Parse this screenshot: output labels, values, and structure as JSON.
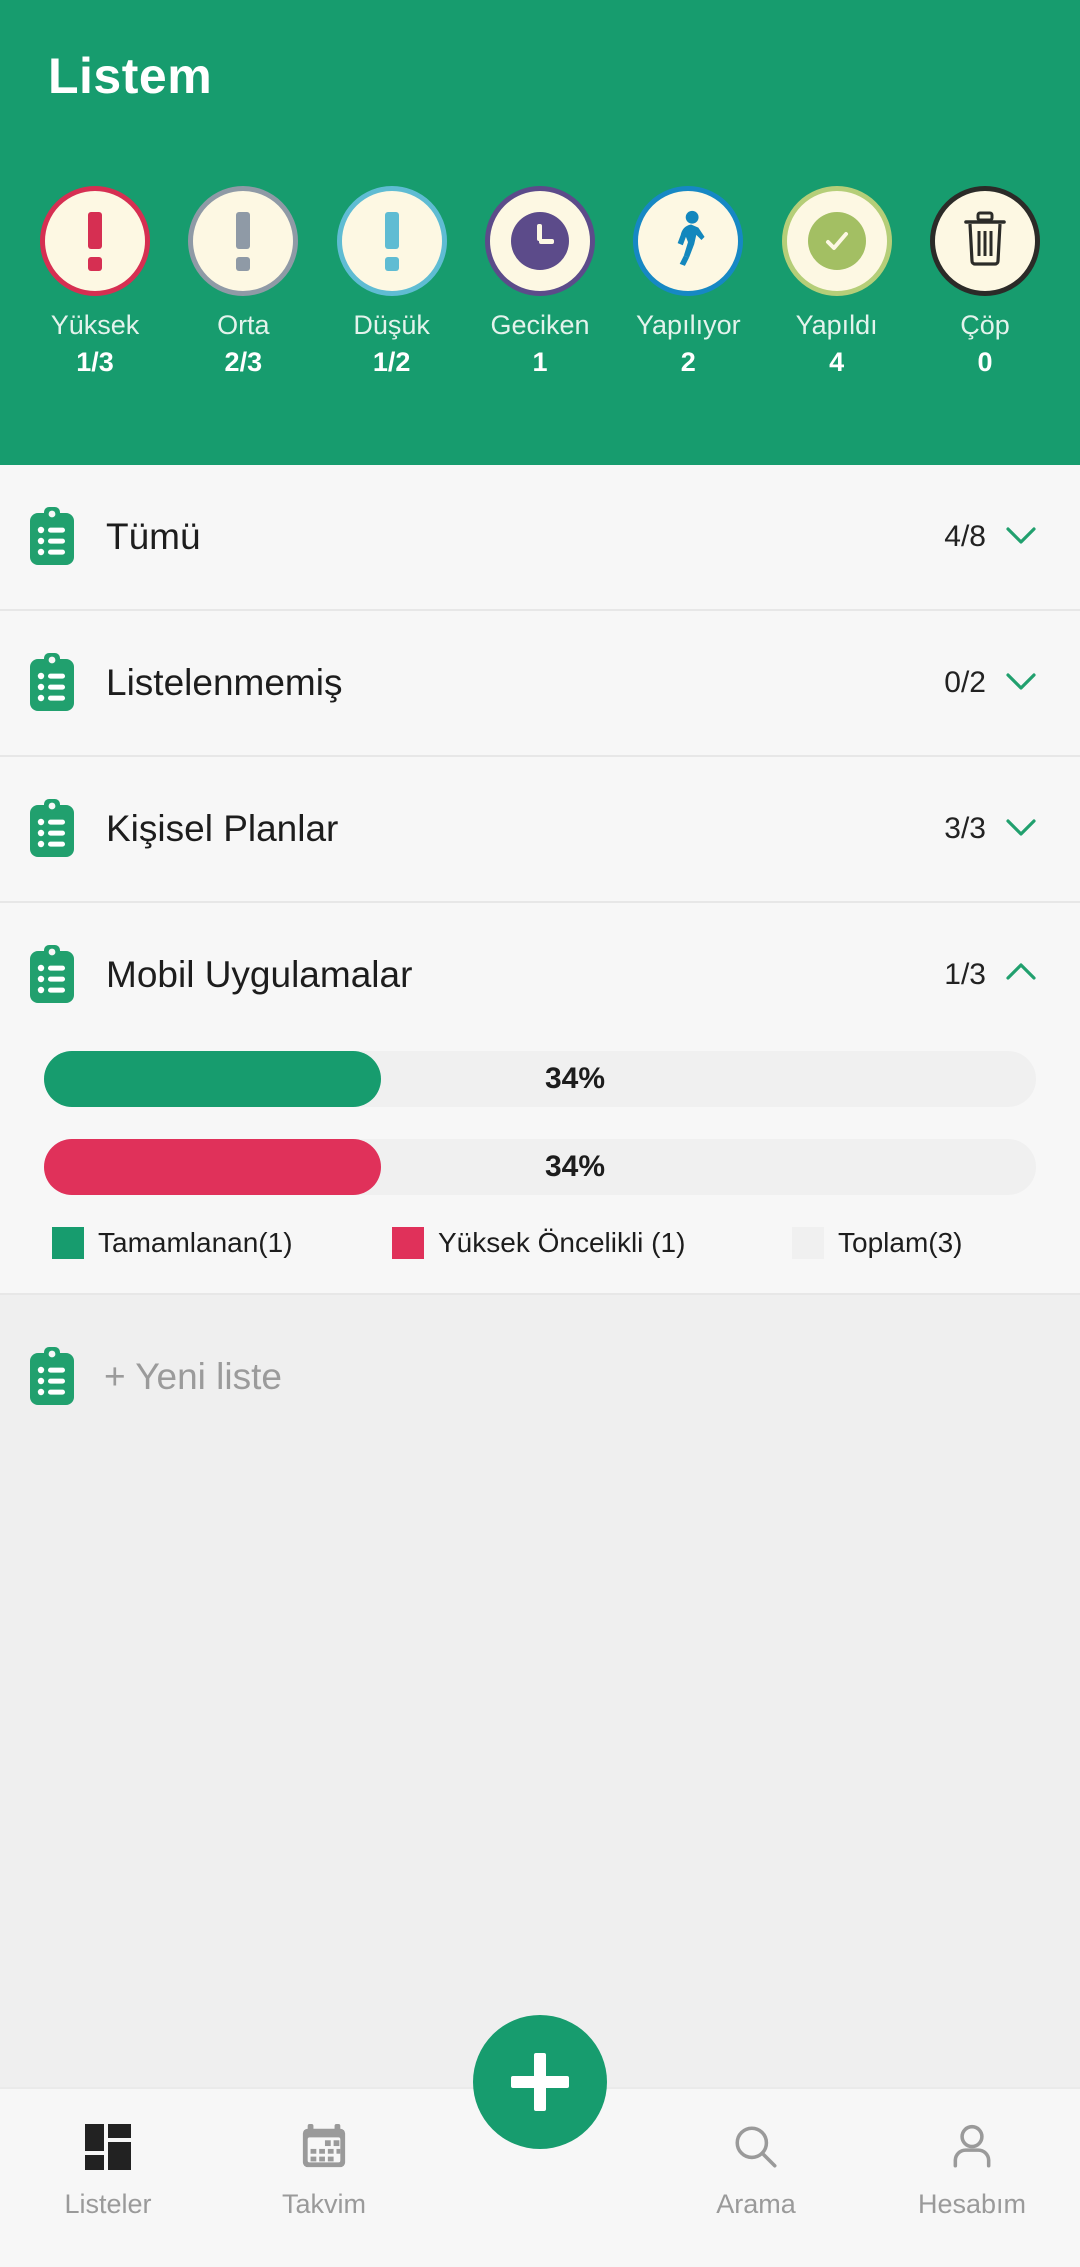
{
  "header": {
    "title": "Listem",
    "bg_color": "#179c6e",
    "statuses": [
      {
        "label": "Yüksek",
        "count": "1/3",
        "icon": "exclamation-icon",
        "ring_color": "#d62f52",
        "accent": "#d62f52"
      },
      {
        "label": "Orta",
        "count": "2/3",
        "icon": "exclamation-icon",
        "ring_color": "#8f9aa6",
        "accent": "#8f9aa6"
      },
      {
        "label": "Düşük",
        "count": "1/2",
        "icon": "exclamation-icon",
        "ring_color": "#5fbcd3",
        "accent": "#5fbcd3"
      },
      {
        "label": "Geciken",
        "count": "1",
        "icon": "clock-icon",
        "ring_color": "#5c4b8a",
        "accent": "#5c4b8a"
      },
      {
        "label": "Yapılıyor",
        "count": "2",
        "icon": "walking-icon",
        "ring_color": "#1688c4",
        "accent": "#1387bd"
      },
      {
        "label": "Yapıldı",
        "count": "4",
        "icon": "check-icon",
        "ring_color": "#b5ce78",
        "accent": "#a3bf63"
      },
      {
        "label": "Çöp",
        "count": "0",
        "icon": "trash-icon",
        "ring_color": "#2b2b28",
        "accent": "#2b2b28"
      }
    ]
  },
  "lists": [
    {
      "name": "Tümü",
      "count": "4/8",
      "expanded": false,
      "icon": "clipboard-icon"
    },
    {
      "name": "Listelenmemiş",
      "count": "0/2",
      "expanded": false,
      "icon": "clipboard-icon"
    },
    {
      "name": "Kişisel Planlar",
      "count": "3/3",
      "expanded": false,
      "icon": "clipboard-icon"
    },
    {
      "name": "Mobil Uygulamalar",
      "count": "1/3",
      "expanded": true,
      "icon": "clipboard-icon"
    }
  ],
  "expanded_detail": {
    "bars": [
      {
        "label": "34%",
        "value": 34,
        "color": "#179c6e"
      },
      {
        "label": "34%",
        "value": 34,
        "color": "#e0315a"
      }
    ],
    "legend": [
      {
        "label": "Tamamlanan(1)",
        "color": "#179c6e"
      },
      {
        "label": "Yüksek Öncelikli (1)",
        "color": "#e0315a"
      },
      {
        "label": "Toplam(3)",
        "color": "#f0f0f0"
      }
    ]
  },
  "new_list": {
    "label": "+ Yeni liste",
    "icon": "clipboard-icon"
  },
  "bottom_nav": {
    "fab": {
      "icon": "plus-icon",
      "color": "#179c6e"
    },
    "items": [
      {
        "label": "Listeler",
        "icon": "dashboard-grid-icon",
        "active": true
      },
      {
        "label": "Takvim",
        "icon": "calendar-icon",
        "active": false
      },
      {
        "label": "Arama",
        "icon": "search-icon",
        "active": false
      },
      {
        "label": "Hesabım",
        "icon": "person-icon",
        "active": false
      }
    ]
  }
}
